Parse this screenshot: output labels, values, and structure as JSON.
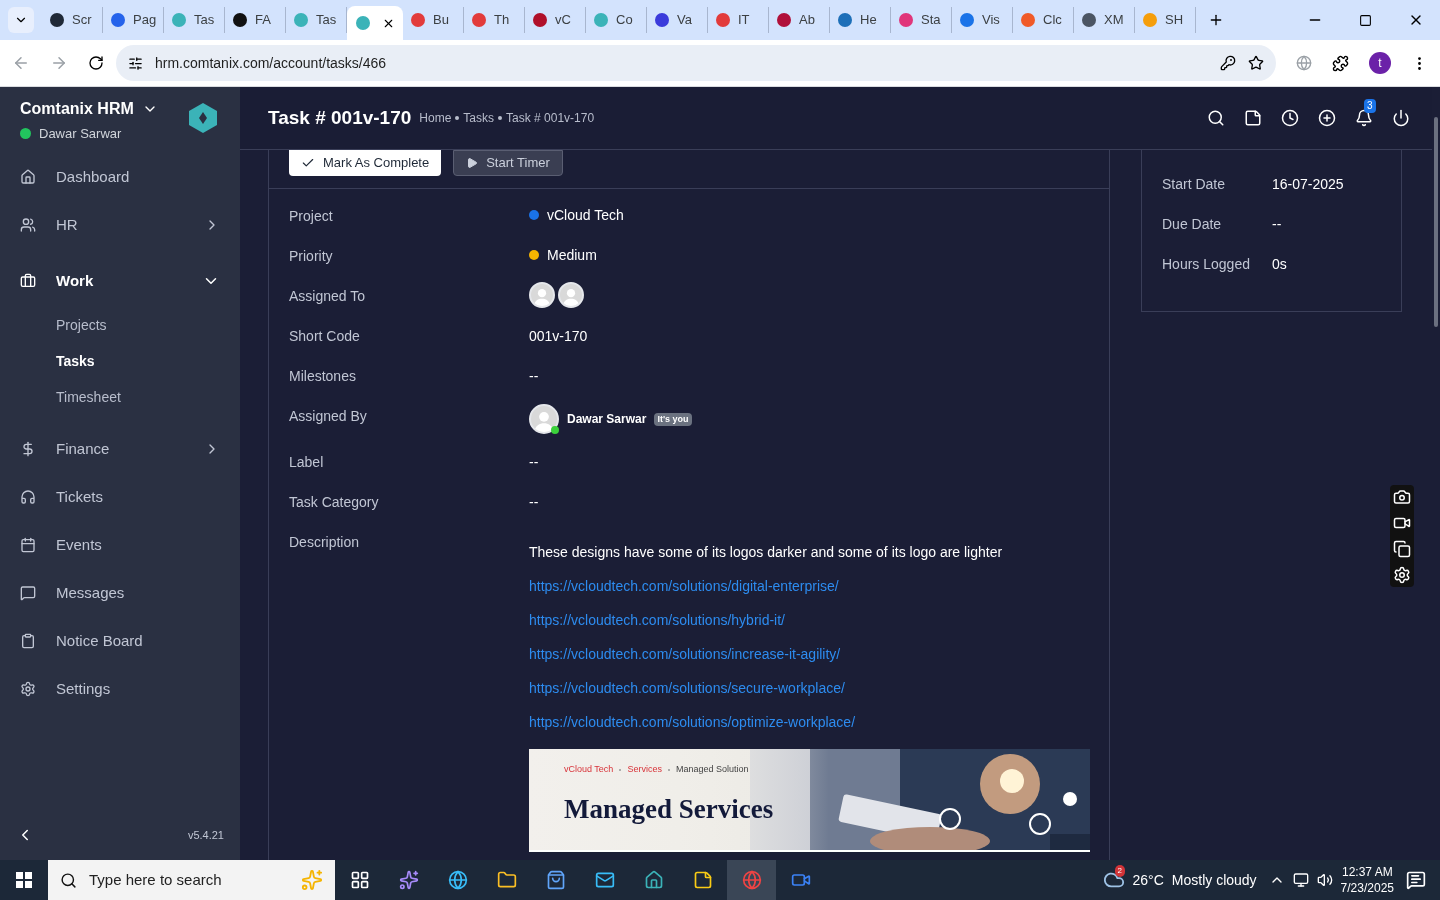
{
  "browser": {
    "tabs": [
      {
        "label": "Scr",
        "selected": false,
        "color": "#1f2937"
      },
      {
        "label": "Pag",
        "selected": false,
        "color": "#2563eb"
      },
      {
        "label": "Tas",
        "selected": false,
        "color": "#3bb3b8"
      },
      {
        "label": "FA",
        "selected": false,
        "color": "#111111"
      },
      {
        "label": "Tas",
        "selected": false,
        "color": "#3bb3b8"
      },
      {
        "selected": true,
        "color": "#3bb3b8"
      },
      {
        "label": "Bu",
        "selected": false,
        "color": "#e23b3b"
      },
      {
        "label": "Th",
        "selected": false,
        "color": "#e23b3b"
      },
      {
        "label": "vC",
        "selected": false,
        "color": "#b0102a"
      },
      {
        "label": "Co",
        "selected": false,
        "color": "#3bb3b8"
      },
      {
        "label": "Va",
        "selected": false,
        "color": "#3b3bdb"
      },
      {
        "label": "IT",
        "selected": false,
        "color": "#e23b3b"
      },
      {
        "label": "Ab",
        "selected": false,
        "color": "#b0103a"
      },
      {
        "label": "He",
        "selected": false,
        "color": "#1d6fb8"
      },
      {
        "label": "Sta",
        "selected": false,
        "color": "#e0357a"
      },
      {
        "label": "Vis",
        "selected": false,
        "color": "#1a73e8"
      },
      {
        "label": "Clc",
        "selected": false,
        "color": "#f05a28"
      },
      {
        "label": "XM",
        "selected": false,
        "color": "#4b5563"
      },
      {
        "label": "SH",
        "selected": false,
        "color": "#f59e0b"
      }
    ],
    "url": "hrm.comtanix.com/account/tasks/466",
    "profile_initial": "t"
  },
  "sidebar": {
    "brand": "Comtanix HRM",
    "user": "Dawar Sarwar",
    "version": "v5.4.21",
    "items": [
      {
        "label": "Dashboard",
        "kind": "link",
        "selected": false
      },
      {
        "label": "HR",
        "kind": "group",
        "expanded": false
      },
      {
        "label": "Work",
        "kind": "group",
        "expanded": true,
        "children": [
          {
            "label": "Projects",
            "selected": false
          },
          {
            "label": "Tasks",
            "selected": true
          },
          {
            "label": "Timesheet",
            "selected": false
          }
        ]
      },
      {
        "label": "Finance",
        "kind": "group",
        "expanded": false
      },
      {
        "label": "Tickets",
        "kind": "link",
        "selected": false
      },
      {
        "label": "Events",
        "kind": "link",
        "selected": false
      },
      {
        "label": "Messages",
        "kind": "link",
        "selected": false
      },
      {
        "label": "Notice Board",
        "kind": "link",
        "selected": false
      },
      {
        "label": "Settings",
        "kind": "link",
        "selected": false
      }
    ]
  },
  "header": {
    "title": "Task # 001v-170",
    "breadcrumbs": [
      "Home",
      "Tasks",
      "Task # 001v-170"
    ],
    "notification_count": "3"
  },
  "actions": [
    "Mark As Complete",
    "Start Timer"
  ],
  "details": [
    {
      "label": "Project",
      "kind": "dot",
      "value": "vCloud Tech",
      "color": "#1a73e8"
    },
    {
      "label": "Priority",
      "kind": "dot",
      "value": "Medium",
      "color": "#f5b400"
    },
    {
      "label": "Assigned To",
      "kind": "avatars"
    },
    {
      "label": "Short Code",
      "kind": "text",
      "value": "001v-170"
    },
    {
      "label": "Milestones",
      "kind": "text",
      "value": "--"
    },
    {
      "label": "Assigned By",
      "kind": "user",
      "value": "Dawar Sarwar",
      "badge": "It's you"
    },
    {
      "label": "Label",
      "kind": "text",
      "value": "--"
    },
    {
      "label": "Task Category",
      "kind": "text",
      "value": "--"
    },
    {
      "label": "Description",
      "kind": "description",
      "value": "These designs have some of its logos darker and some of its logo are lighter",
      "links": [
        "https://vcloudtech.com/solutions/digital-enterprise/",
        "https://vcloudtech.com/solutions/hybrid-it/",
        "https://vcloudtech.com/solutions/increase-it-agility/",
        "https://vcloudtech.com/solutions/secure-workplace/",
        "https://vcloudtech.com/solutions/optimize-workplace/"
      ],
      "banner": {
        "breadcrumbs": [
          "vCloud Tech",
          "Services",
          "Managed Solution"
        ],
        "heading": "Managed Services"
      }
    }
  ],
  "info_card": [
    {
      "label": "Start Date",
      "value": "16-07-2025"
    },
    {
      "label": "Due Date",
      "value": "--"
    },
    {
      "label": "Hours Logged",
      "value": "0s"
    }
  ],
  "taskbar": {
    "search_placeholder": "Type here to search",
    "weather_badge": "2",
    "temperature": "26°C",
    "weather": "Mostly cloudy",
    "time": "12:37 AM",
    "date": "7/23/2025"
  }
}
